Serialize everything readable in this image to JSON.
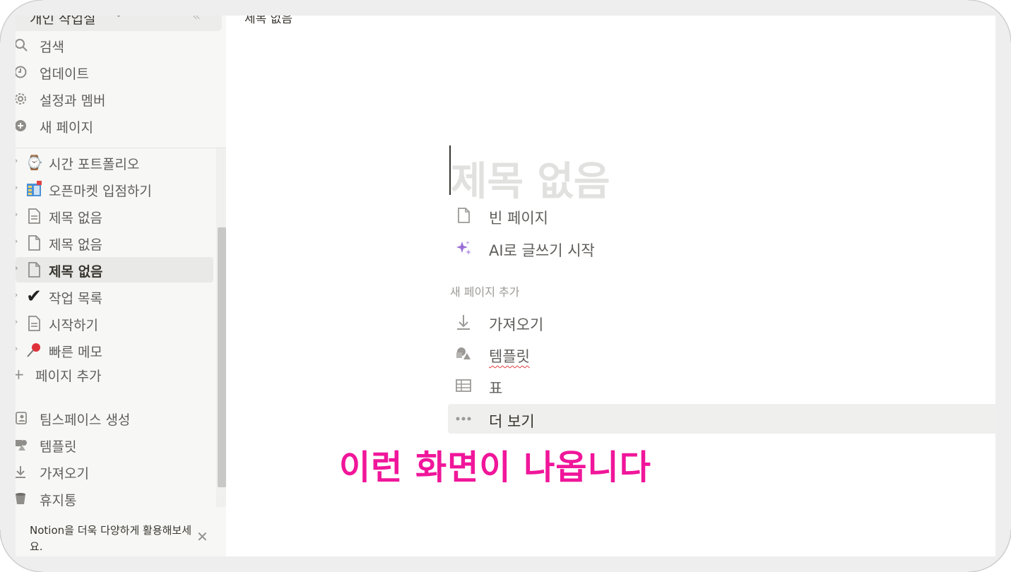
{
  "sidebar": {
    "workspace_name": "개인 작업실",
    "menu": [
      {
        "label": "검색",
        "icon": "search-icon"
      },
      {
        "label": "업데이트",
        "icon": "clock-icon"
      },
      {
        "label": "설정과 멤버",
        "icon": "gear-icon"
      },
      {
        "label": "새 페이지",
        "icon": "plus-circle-icon"
      }
    ],
    "pages": [
      {
        "label": "시간 포트폴리오",
        "icon": "watch-icon"
      },
      {
        "label": "오픈마켓 입점하기",
        "icon": "building-icon"
      },
      {
        "label": "제목 없음",
        "icon": "page-lines-icon"
      },
      {
        "label": "제목 없음",
        "icon": "page-icon"
      },
      {
        "label": "제목 없음",
        "icon": "page-icon",
        "active": true
      },
      {
        "label": "작업 목록",
        "icon": "checkmark-icon"
      },
      {
        "label": "시작하기",
        "icon": "page-lines-icon"
      },
      {
        "label": "빠른 메모",
        "icon": "pushpin-icon"
      }
    ],
    "add_page": "페이지 추가",
    "bottom": [
      {
        "label": "팀스페이스 생성",
        "icon": "teamspace-icon"
      },
      {
        "label": "템플릿",
        "icon": "template-icon"
      },
      {
        "label": "가져오기",
        "icon": "import-icon"
      },
      {
        "label": "휴지통",
        "icon": "trash-icon"
      }
    ],
    "promo_text": "Notion을 더욱 다양하게 활용해보세요."
  },
  "main": {
    "breadcrumb": "제목 없음",
    "title_placeholder": "제목 없음",
    "options": [
      {
        "label": "빈 페이지",
        "icon": "page-icon"
      },
      {
        "label": "AI로 글쓰기 시작",
        "icon": "sparkle-icon"
      }
    ],
    "add_section_label": "새 페이지 추가",
    "add_options": [
      {
        "label": "가져오기",
        "icon": "import-icon"
      },
      {
        "label": "템플릿",
        "icon": "template-icon"
      },
      {
        "label": "표",
        "icon": "table-icon"
      },
      {
        "label": "더 보기",
        "icon": "more-icon"
      }
    ]
  },
  "annotation": "이런 화면이 나옵니다",
  "colors": {
    "annotation": "#f0169a",
    "sidebar_bg": "#f7f7f5",
    "ai_sparkle": "#9a6dd7"
  }
}
